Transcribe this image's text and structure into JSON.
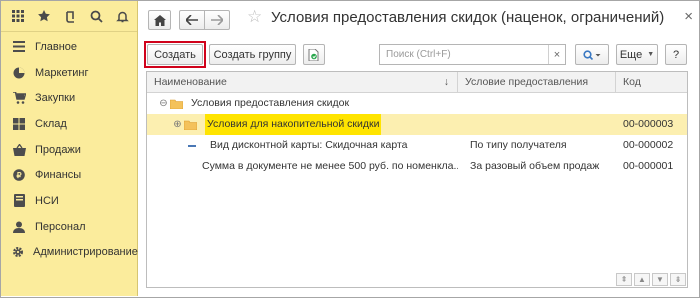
{
  "topbar": {
    "icons": [
      "apps-grid-icon",
      "star-icon",
      "history-icon",
      "search-icon",
      "bell-icon"
    ]
  },
  "sidebar": {
    "items": [
      {
        "label": "Главное",
        "icon": "menu-lines-icon"
      },
      {
        "label": "Маркетинг",
        "icon": "pie-chart-icon"
      },
      {
        "label": "Закупки",
        "icon": "cart-icon"
      },
      {
        "label": "Склад",
        "icon": "warehouse-icon"
      },
      {
        "label": "Продажи",
        "icon": "basket-icon"
      },
      {
        "label": "Финансы",
        "icon": "coins-icon"
      },
      {
        "label": "НСИ",
        "icon": "book-icon"
      },
      {
        "label": "Персонал",
        "icon": "person-icon"
      },
      {
        "label": "Администрирование",
        "icon": "gear-icon"
      }
    ]
  },
  "header": {
    "title": "Условия предоставления скидок (наценок, ограничений)",
    "close": "×"
  },
  "toolbar": {
    "create_label": "Создать",
    "create_group_label": "Создать группу",
    "search_placeholder": "Поиск (Ctrl+F)",
    "search_clear": "×",
    "more_label": "Еще",
    "help_label": "?"
  },
  "table": {
    "columns": [
      "Наименование",
      "Условие предоставления",
      "Код"
    ],
    "sort_marker": "↓",
    "rows": [
      {
        "name": "Условия предоставления скидок",
        "condition": "",
        "code": "",
        "kind": "root-folder"
      },
      {
        "name": "Условия для накопительной скидки",
        "condition": "",
        "code": "00-000003",
        "kind": "folder",
        "selected": true
      },
      {
        "name": "Вид дисконтной карты: Скидочная карта",
        "condition": "По типу получателя",
        "code": "00-000002",
        "kind": "item"
      },
      {
        "name": "Сумма в документе не менее 500 руб. по номенкла...",
        "condition": "За разовый объем продаж",
        "code": "00-000001",
        "kind": "item"
      }
    ]
  },
  "colors": {
    "sidebar_bg": "#fbec9c",
    "selected_row": "#fcefb0",
    "highlight": "#ffe400",
    "create_outline": "#d0021b",
    "search_button": "#4a86c8"
  }
}
